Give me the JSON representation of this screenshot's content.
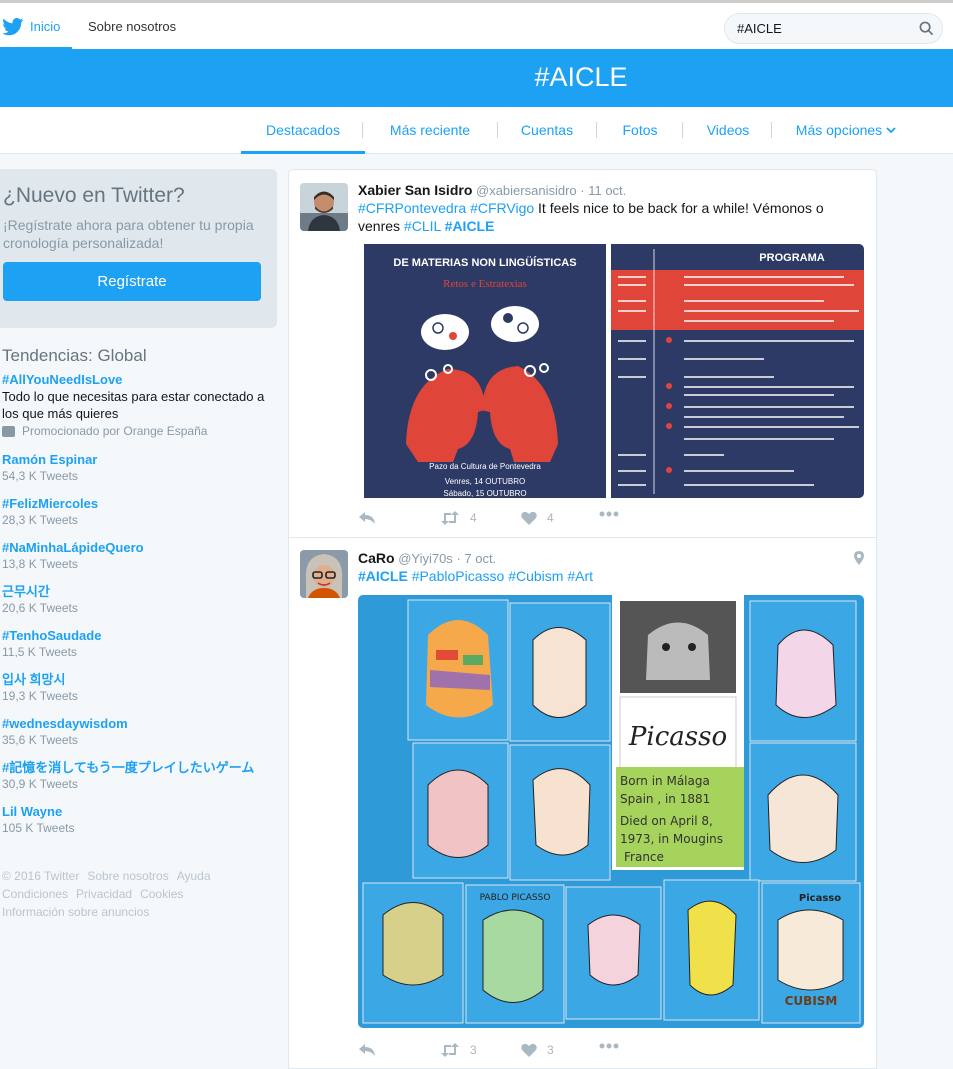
{
  "topbar": {
    "home_label": "Inicio",
    "about_label": "Sobre nosotros",
    "search_value": "#AICLE"
  },
  "banner": {
    "title": "#AICLE"
  },
  "tabs": [
    {
      "label": "Destacados"
    },
    {
      "label": "Más reciente"
    },
    {
      "label": "Cuentas"
    },
    {
      "label": "Fotos"
    },
    {
      "label": "Videos"
    },
    {
      "label": "Más opciones"
    }
  ],
  "signup": {
    "heading": "¿Nuevo en Twitter?",
    "text": "¡Regístrate ahora para obtener tu propia cronología personalizada!",
    "button": "Regístrate"
  },
  "trends": {
    "heading": "Tendencias: Global",
    "items": [
      {
        "name": "#AllYouNeedIsLove",
        "desc": "Todo lo que necesitas para estar conectado a los que más quieres",
        "promo": "Promocionado por Orange España"
      },
      {
        "name": "Ramón Espinar",
        "count": "54,3 K Tweets"
      },
      {
        "name": "#FelizMiercoles",
        "count": "28,3 K Tweets"
      },
      {
        "name": "#NaMinhaLápideQuero",
        "count": "13,8 K Tweets"
      },
      {
        "name": "근무시간",
        "count": "20,6 K Tweets"
      },
      {
        "name": "#TenhoSaudade",
        "count": "11,5 K Tweets"
      },
      {
        "name": "입사 희망시",
        "count": "19,3 K Tweets"
      },
      {
        "name": "#wednesdaywisdom",
        "count": "35,6 K Tweets"
      },
      {
        "name": "#記憶を消してもう一度プレイしたいゲーム",
        "count": "30,9 K Tweets"
      },
      {
        "name": "Lil Wayne",
        "count": "105 K Tweets"
      }
    ]
  },
  "footer": {
    "links": [
      "© 2016 Twitter",
      "Sobre nosotros",
      "Ayuda",
      "Condiciones",
      "Privacidad",
      "Cookies",
      "Información sobre anuncios"
    ]
  },
  "tweets": [
    {
      "name": "Xabier San Isidro",
      "handle": "@xabiersanisidro",
      "time": "· 11 oct.",
      "text_parts": {
        "t1": "#CFRPontevedra",
        "t2": "#CFRVigo",
        "t3": " It feels nice to be back for a while! Vémonos o venres ",
        "t4": "#CLIL",
        "t5": "#AICLE"
      },
      "poster": {
        "heading": "DE MATERIAS NON LINGÜÍSTICAS",
        "subheading": "Retos e Estratexias",
        "venue": "Pazo da Cultura de Pontevedra",
        "date1": "Venres, 14 OUTUBRO",
        "date2": "Sábado, 15 OUTUBRO",
        "program_title": "PROGRAMA"
      },
      "retweets": "4",
      "likes": "4"
    },
    {
      "name": "CaRo",
      "handle": "@Yiyi70s",
      "time": "· 7 oct.",
      "text_parts": {
        "t1": "#AICLE",
        "t2": "#PabloPicasso",
        "t3": "#Cubism",
        "t4": "#Art"
      },
      "art": {
        "sign": "Picasso",
        "note1": "Born in Málaga",
        "note2": "Spain , in 1881",
        "note3": "Died on April 8,",
        "note4": "1973, in Mougins",
        "note5": "France",
        "label_cubism": "CUBISM",
        "label_picasso": "PABLO PICASSO",
        "label_picasso2": "Picasso"
      },
      "retweets": "3",
      "likes": "3"
    }
  ],
  "colors": {
    "accent": "#1da1f2",
    "poster_navy": "#2d3a66",
    "poster_red": "#e0453a",
    "board_blue": "#2f9ad8"
  }
}
